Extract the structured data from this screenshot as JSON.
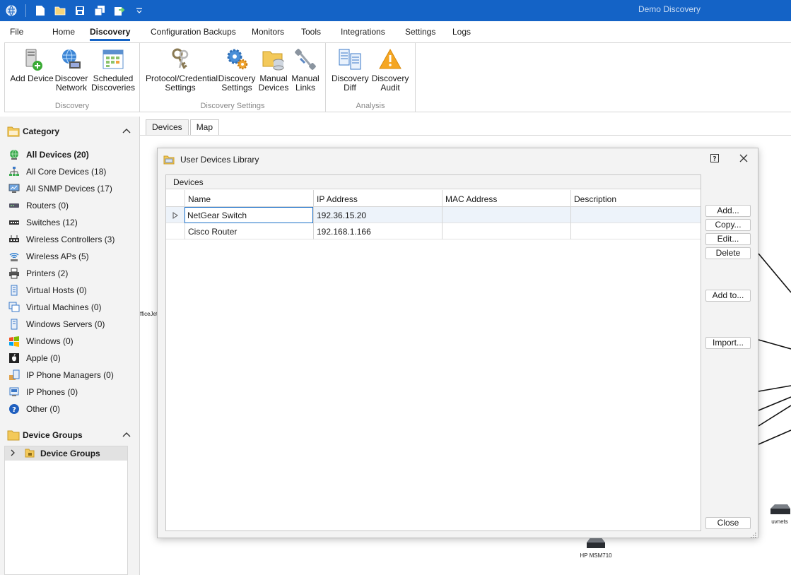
{
  "app": {
    "title": "Demo Discovery"
  },
  "menu": [
    "File",
    "Home",
    "Discovery",
    "Configuration Backups",
    "Monitors",
    "Tools",
    "Integrations",
    "Settings",
    "Logs"
  ],
  "ribbon": {
    "groups": [
      {
        "label": "Discovery",
        "buttons": [
          {
            "line1": "Add Device",
            "line2": "",
            "icon": "add-device-icon"
          },
          {
            "line1": "Discover",
            "line2": "Network",
            "icon": "discover-network-icon"
          },
          {
            "line1": "Scheduled",
            "line2": "Discoveries",
            "icon": "calendar-icon"
          }
        ]
      },
      {
        "label": "Discovery Settings",
        "buttons": [
          {
            "line1": "Protocol/Credential",
            "line2": "Settings",
            "icon": "key-icon"
          },
          {
            "line1": "Discovery",
            "line2": "Settings",
            "icon": "gear-icon"
          },
          {
            "line1": "Manual",
            "line2": "Devices",
            "icon": "folder-database-icon"
          },
          {
            "line1": "Manual",
            "line2": "Links",
            "icon": "link-icon"
          }
        ]
      },
      {
        "label": "Analysis",
        "buttons": [
          {
            "line1": "Discovery",
            "line2": "Diff",
            "icon": "diff-icon"
          },
          {
            "line1": "Discovery",
            "line2": "Audit",
            "icon": "warning-icon"
          }
        ]
      }
    ]
  },
  "left": {
    "category_title": "Category",
    "categories": [
      "All Devices (20)",
      "All Core Devices (18)",
      "All SNMP Devices (17)",
      "Routers (0)",
      "Switches (12)",
      "Wireless Controllers (3)",
      "Wireless APs (5)",
      "Printers (2)",
      "Virtual Hosts (0)",
      "Virtual Machines (0)",
      "Windows Servers (0)",
      "Windows (0)",
      "Apple (0)",
      "IP Phone Managers (0)",
      "IP Phones (0)",
      "Other (0)"
    ],
    "groups_title": "Device Groups",
    "group_items": [
      "Device Groups"
    ]
  },
  "tabs": [
    "Devices",
    "Map"
  ],
  "dialog": {
    "title": "User Devices Library",
    "section": "Devices",
    "columns": [
      "Name",
      "IP Address",
      "MAC Address",
      "Description"
    ],
    "rows": [
      {
        "name": "NetGear Switch",
        "ip": "192.36.15.20",
        "mac": "",
        "description": ""
      },
      {
        "name": "Cisco Router",
        "ip": "192.168.1.166",
        "mac": "",
        "description": ""
      }
    ],
    "buttons": {
      "add": "Add...",
      "copy": "Copy...",
      "edit": "Edit...",
      "delete": "Delete",
      "add_to": "Add to...",
      "import": "Import...",
      "close": "Close"
    }
  },
  "map": {
    "labels": [
      "fficeJet",
      "HP MSM710",
      "uvnets"
    ]
  },
  "colors": {
    "accent": "#1463c6",
    "panel": "#f3f3f3",
    "border": "#d7d7d7",
    "focus": "#1a6fc8"
  }
}
